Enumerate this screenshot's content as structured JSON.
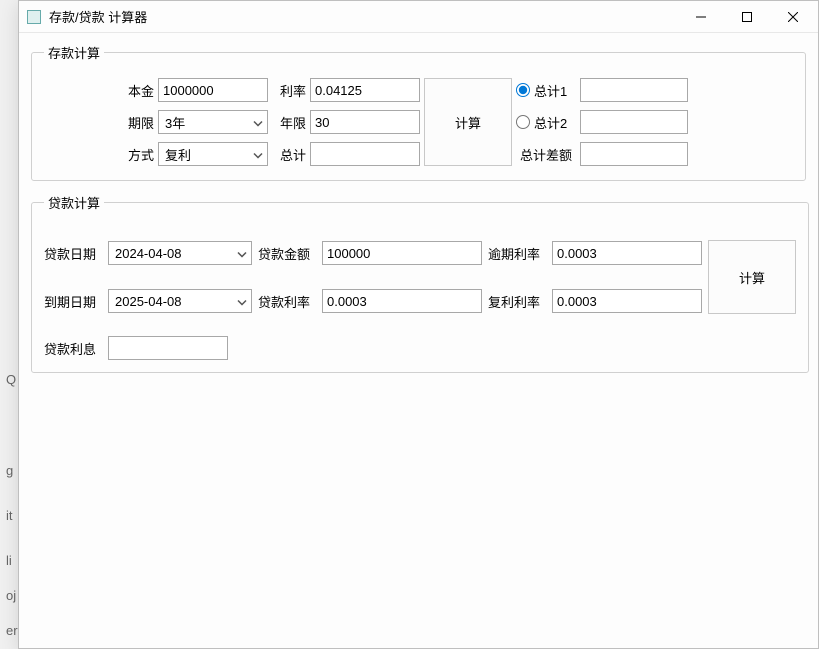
{
  "window": {
    "title": "存款/贷款 计算器"
  },
  "deposit": {
    "legend": "存款计算",
    "principal_label": "本金",
    "principal_value": "1000000",
    "rate_label": "利率",
    "rate_value": "0.04125",
    "term_label": "期限",
    "term_value": "3年",
    "years_label": "年限",
    "years_value": "30",
    "method_label": "方式",
    "method_value": "复利",
    "total_label": "总计",
    "total_value": "",
    "calc_button": "计算",
    "total1_label": "总计1",
    "total1_value": "",
    "total2_label": "总计2",
    "total2_value": "",
    "diff_label": "总计差额",
    "diff_value": ""
  },
  "loan": {
    "legend": "贷款计算",
    "loan_date_label": "贷款日期",
    "loan_date_value": "2024-04-08",
    "loan_amount_label": "贷款金额",
    "loan_amount_value": "100000",
    "overdue_rate_label": "逾期利率",
    "overdue_rate_value": "0.0003",
    "due_date_label": "到期日期",
    "due_date_value": "2025-04-08",
    "loan_rate_label": "贷款利率",
    "loan_rate_value": "0.0003",
    "compound_rate_label": "复利利率",
    "compound_rate_value": "0.0003",
    "calc_button": "计算",
    "interest_label": "贷款利息",
    "interest_value": ""
  },
  "bg_letters": [
    "Q",
    "g",
    "it",
    "li",
    "oj",
    "er"
  ]
}
